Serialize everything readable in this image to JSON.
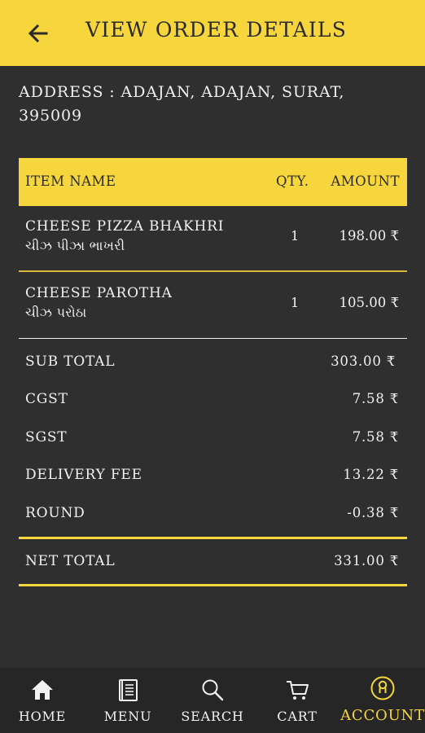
{
  "appbar": {
    "title": "VIEW ORDER DETAILS",
    "back_icon": "arrow-left-icon"
  },
  "address": "ADDRESS : ADAJAN, ADAJAN, SURAT, 395009",
  "table": {
    "headers": {
      "item": "ITEM NAME",
      "qty": "QTY.",
      "amount": "AMOUNT"
    },
    "items": [
      {
        "name": "CHEESE PIZZA BHAKHRI",
        "name_gu": "ચીઝ પીઝા ભાખરી",
        "qty": "1",
        "amount": "198.00 ₹"
      },
      {
        "name": "CHEESE PAROTHA",
        "name_gu": "ચીઝ પરોઠા",
        "qty": "1",
        "amount": "105.00 ₹"
      }
    ]
  },
  "summary": [
    {
      "label": "SUB TOTAL",
      "value": "303.00 ₹"
    },
    {
      "label": "CGST",
      "value": "7.58 ₹"
    },
    {
      "label": "SGST",
      "value": "7.58 ₹"
    },
    {
      "label": "DELIVERY FEE",
      "value": "13.22 ₹"
    },
    {
      "label": "ROUND",
      "value": "-0.38 ₹"
    }
  ],
  "net_total": {
    "label": "NET TOTAL",
    "value": "331.00 ₹"
  },
  "nav": [
    {
      "label": "HOME",
      "icon": "home-icon",
      "active": false
    },
    {
      "label": "MENU",
      "icon": "menu-book-icon",
      "active": false
    },
    {
      "label": "SEARCH",
      "icon": "search-icon",
      "active": false
    },
    {
      "label": "CART",
      "icon": "cart-icon",
      "active": false
    },
    {
      "label": "ACCOUNT",
      "icon": "account-icon",
      "active": true
    }
  ],
  "colors": {
    "accent": "#f6d63c",
    "background": "#2f2f2f",
    "nav_background": "#262626",
    "text": "#f2f2f2"
  }
}
